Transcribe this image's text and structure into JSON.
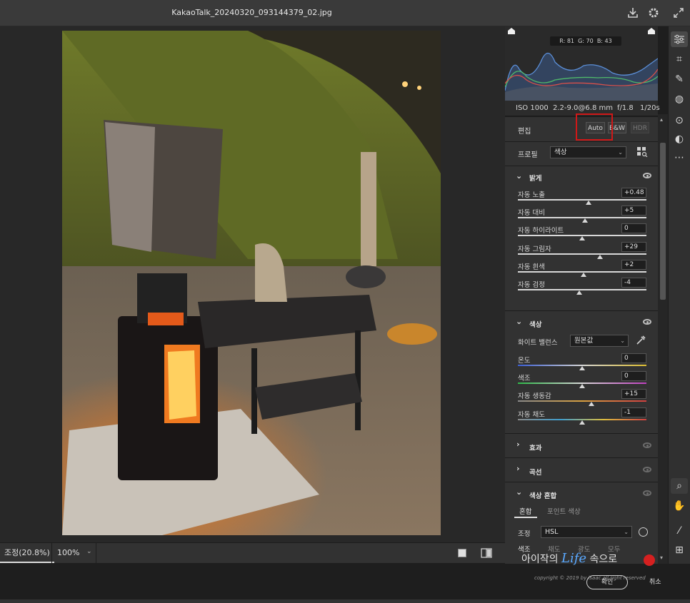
{
  "window": {
    "filename": "KakaoTalk_20240320_093144379_02.jpg"
  },
  "histogram": {
    "r": "R: 81",
    "g": "G: 70",
    "b": "B: 43"
  },
  "metadata": {
    "iso": "ISO 1000",
    "lens": "2.2-9.0@6.8 mm",
    "aperture": "f/1.8",
    "shutter": "1/20s"
  },
  "edit": {
    "label": "편집",
    "auto": "Auto",
    "bw": "B&W",
    "hdr": "HDR"
  },
  "profile": {
    "label": "프로필",
    "value": "색상"
  },
  "light": {
    "title": "밝게",
    "sliders": [
      {
        "label": "자동 노출",
        "value": "+0.48",
        "pos": 0.55
      },
      {
        "label": "자동 대비",
        "value": "+5",
        "pos": 0.52
      },
      {
        "label": "자동 하이라이트",
        "value": "0",
        "pos": 0.5
      },
      {
        "label": "자동 그림자",
        "value": "+29",
        "pos": 0.64
      },
      {
        "label": "자동 흰색",
        "value": "+2",
        "pos": 0.51
      },
      {
        "label": "자동 검정",
        "value": "-4",
        "pos": 0.48
      }
    ]
  },
  "color": {
    "title": "색상",
    "wb_label": "화이트 밸런스",
    "wb_value": "원본값",
    "sliders": [
      {
        "label": "온도",
        "value": "0",
        "pos": 0.5
      },
      {
        "label": "색조",
        "value": "0",
        "pos": 0.5
      },
      {
        "label": "자동 생동감",
        "value": "+15",
        "pos": 0.57
      },
      {
        "label": "자동 채도",
        "value": "-1",
        "pos": 0.5
      }
    ]
  },
  "effects": {
    "title": "효과"
  },
  "curve": {
    "title": "곡선"
  },
  "mixer": {
    "title": "색상 혼합",
    "tab_mix": "혼합",
    "tab_point": "포인트 색상",
    "adjust_label": "조정",
    "adjust_value": "HSL",
    "sub_hue": "색조",
    "sub_sat": "채도",
    "sub_lum": "광도",
    "sub_all": "모두"
  },
  "bottombar": {
    "fit": "조정(20.8%)",
    "zoom": "100%"
  },
  "footer": {
    "ok": "확인",
    "cancel": "취소"
  },
  "watermark": {
    "pre": "아이작의",
    "life": "Life",
    "post": "속으로",
    "copyright": "copyright © 2019 by isaac all right reserved"
  },
  "colors": {
    "highlight_box": "#d01818",
    "panel": "#2c2c2c",
    "section": "#323232"
  }
}
